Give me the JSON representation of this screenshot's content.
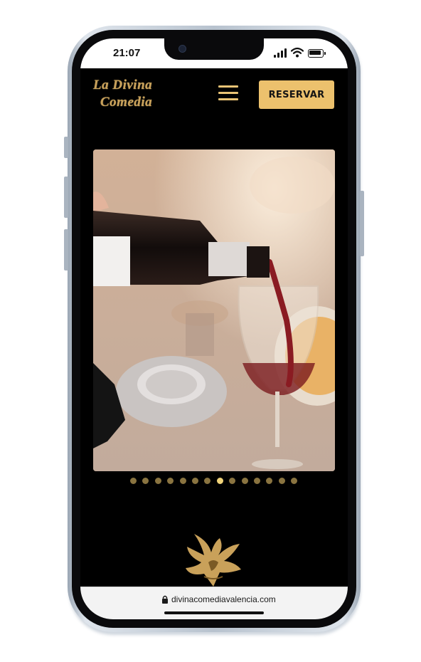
{
  "status_bar": {
    "time": "21:07"
  },
  "header": {
    "logo_line1": "La Divina",
    "logo_line2": "Comedia",
    "reserve_label": "RESERVAR"
  },
  "carousel": {
    "image_icon": "wine-pour-photo",
    "dots_total": 14,
    "active_index": 7
  },
  "browser": {
    "url": "divinacomediavalencia.com",
    "lock_icon": "lock-icon"
  },
  "colors": {
    "gold": "#ecc16d",
    "background": "#000000",
    "dot_active": "#f0d37a",
    "dot_inactive": "#8a7440"
  }
}
